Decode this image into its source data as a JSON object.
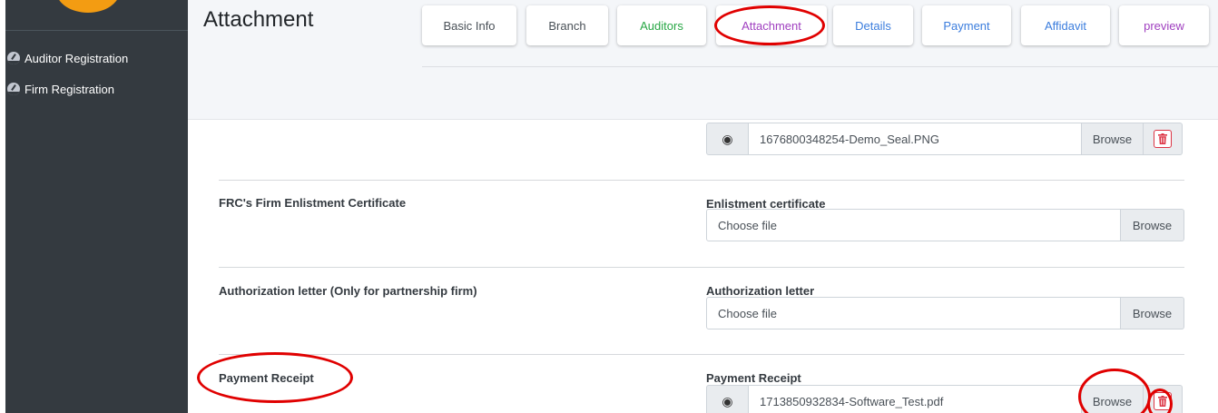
{
  "sidebar": {
    "items": [
      {
        "label": "Auditor Registration",
        "icon": "dashboard-icon"
      },
      {
        "label": "Firm Registration",
        "icon": "dashboard-icon"
      }
    ]
  },
  "header": {
    "title": "Attachment",
    "tabs": [
      {
        "label": "Basic Info",
        "color": "#495057"
      },
      {
        "label": "Branch",
        "color": "#495057"
      },
      {
        "label": "Auditors",
        "color": "#28a745"
      },
      {
        "label": "Attachment",
        "color": "#a040c0"
      },
      {
        "label": "Details",
        "color": "#3b7ddd"
      },
      {
        "label": "Payment",
        "color": "#3b7ddd"
      },
      {
        "label": "Affidavit",
        "color": "#3b7ddd"
      },
      {
        "label": "preview",
        "color": "#a040c0"
      }
    ]
  },
  "seal": {
    "file_name": "1676800348254-Demo_Seal.PNG",
    "browse_label": "Browse"
  },
  "enlistment": {
    "section_label": "FRC's Firm Enlistment Certificate",
    "field_label": "Enlistment certificate",
    "placeholder": "Choose file",
    "browse_label": "Browse"
  },
  "authorization": {
    "section_label": "Authorization letter (Only for partnership firm)",
    "field_label": "Authorization letter",
    "placeholder": "Choose file",
    "browse_label": "Browse"
  },
  "payment_receipt": {
    "section_label": "Payment Receipt",
    "field_label": "Payment Receipt",
    "file_name": "1713850932834-Software_Test.pdf",
    "browse_label": "Browse"
  },
  "colors": {
    "sidebar_bg": "#343a40",
    "annotation_red": "#e00000",
    "delete_red": "#dc3545"
  }
}
